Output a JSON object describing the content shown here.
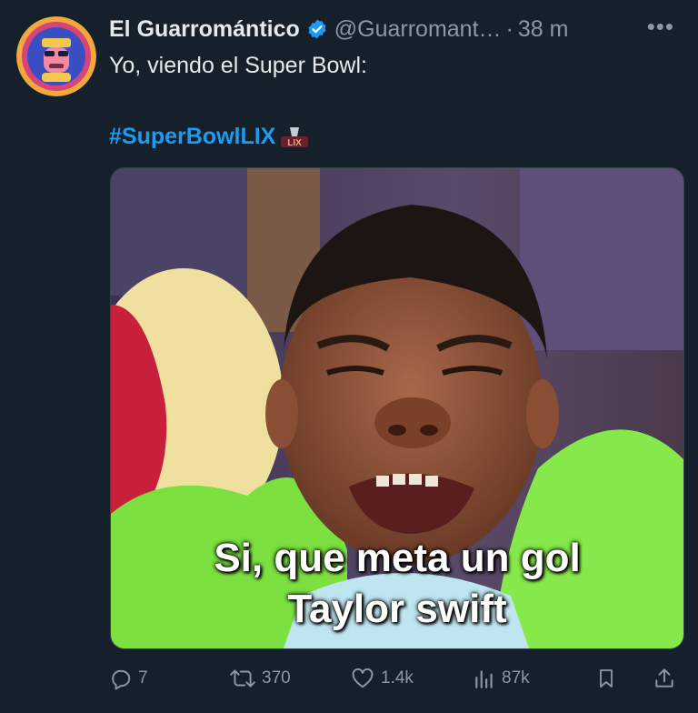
{
  "author": {
    "name": "El Guarromántico",
    "handle": "@Guarromant…",
    "separator": "·",
    "time": "38 m",
    "verified_icon": "verified-badge-icon"
  },
  "tweet": {
    "text": "Yo, viendo el Super Bowl:",
    "hashtag": "#SuperBowlLIX",
    "hashtag_emoji_text": "LIX"
  },
  "media": {
    "caption_line1": "Si, que meta un gol",
    "caption_line2": "Taylor swift"
  },
  "actions": {
    "replies": "7",
    "retweets": "370",
    "likes": "1.4k",
    "views": "87k"
  },
  "colors": {
    "background": "#15202b",
    "accent": "#1d9bf0",
    "muted": "#8b98a5"
  }
}
